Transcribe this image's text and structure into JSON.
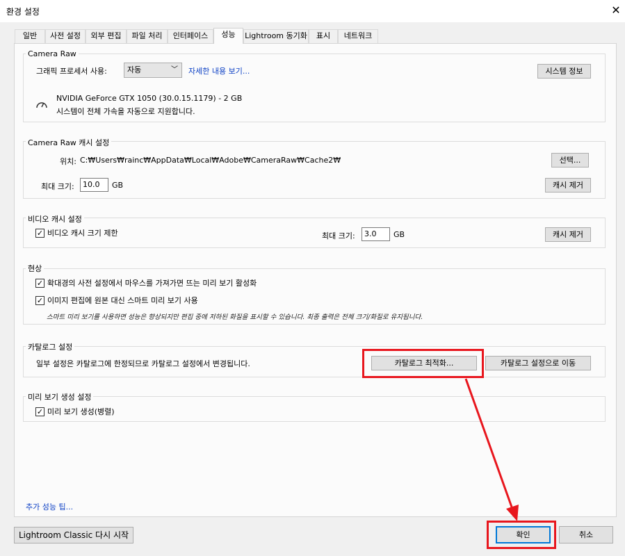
{
  "window": {
    "title": "환경 설정"
  },
  "tabs": [
    {
      "label": "일반"
    },
    {
      "label": "사전 설정"
    },
    {
      "label": "외부 편집"
    },
    {
      "label": "파일 처리"
    },
    {
      "label": "인터페이스"
    },
    {
      "label": "성능"
    },
    {
      "label": "Lightroom 동기화"
    },
    {
      "label": "표시"
    },
    {
      "label": "네트워크"
    }
  ],
  "camera_raw": {
    "title": "Camera Raw",
    "gpu_label": "그래픽 프로세서 사용:",
    "gpu_value": "자동",
    "details_link": "자세한 내용 보기...",
    "system_info_button": "시스템 정보",
    "gpu_name": "NVIDIA GeForce GTX 1050 (30.0.15.1179) - 2 GB",
    "gpu_status": "시스템이 전체 가속을 자동으로 지원합니다."
  },
  "cache": {
    "title": "Camera Raw 캐시 설정",
    "location_label": "위치:",
    "location_path": "C:₩Users₩rainc₩AppData₩Local₩Adobe₩CameraRaw₩Cache2₩",
    "choose_button": "선택...",
    "max_size_label": "최대 크기:",
    "max_size_value": "10.0",
    "unit": "GB",
    "purge_button": "캐시 제거"
  },
  "video_cache": {
    "title": "비디오 캐시 설정",
    "limit_label": "비디오 캐시 크기 제한",
    "max_size_label": "최대 크기:",
    "max_size_value": "3.0",
    "unit": "GB",
    "purge_button": "캐시 제거"
  },
  "develop": {
    "title": "현상",
    "option1": "확대경의 사전 설정에서 마우스를 가져가면 뜨는 미리 보기 활성화",
    "option2": "이미지 편집에 원본 대신 스마트 미리 보기 사용",
    "note": "스마트 미리 보기를 사용하면 성능은 향상되지만 편집 중에 저하된 화질을 표시할 수 있습니다. 최종 출력은 전체 크기/화질로 유지됩니다."
  },
  "catalog": {
    "title": "카탈로그 설정",
    "description": "일부 설정은 카탈로그에 한정되므로 카탈로그 설정에서 변경됩니다.",
    "optimize_button": "카탈로그 최적화...",
    "go_button": "카탈로그 설정으로 이동"
  },
  "preview": {
    "title": "미리 보기 생성 설정",
    "parallel_label": "미리 보기 생성(병렬)"
  },
  "more_tips_link": "추가 성능 팁...",
  "footer": {
    "restart_button": "Lightroom Classic 다시 시작",
    "ok_button": "확인",
    "cancel_button": "취소"
  },
  "checkmark": "✓",
  "annotation_color": "#e8161d"
}
